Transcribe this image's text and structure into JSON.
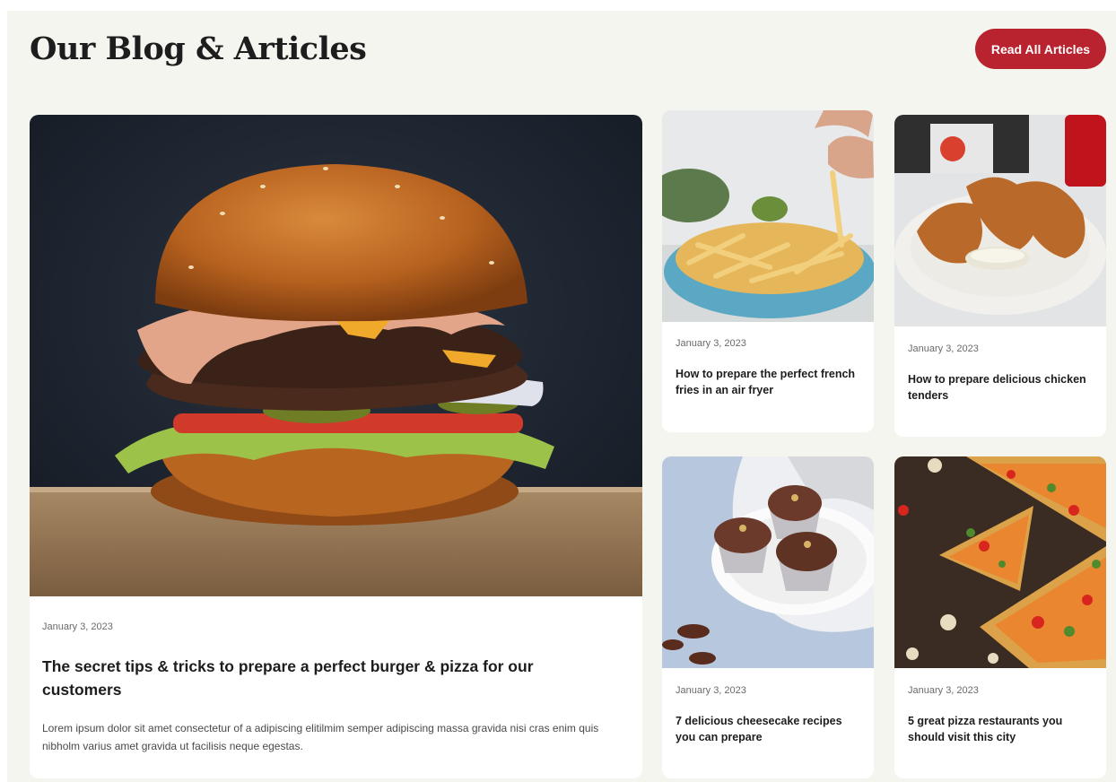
{
  "header": {
    "title": "Our Blog & Articles",
    "read_all_label": "Read All Articles"
  },
  "colors": {
    "accent": "#b8232f",
    "background": "#f5f5f0",
    "card": "#ffffff",
    "text": "#1d1d1d",
    "muted": "#6b6b6b"
  },
  "featured": {
    "image_icon": "burger-photo",
    "date": "January 3, 2023",
    "title": "The secret tips & tricks to prepare a perfect burger & pizza for our customers",
    "excerpt": "Lorem ipsum dolor sit amet consectetur of a adipiscing elitilmim semper adipiscing massa gravida nisi cras enim quis nibholm varius amet gravida ut facilisis neque egestas."
  },
  "articles": [
    {
      "image_icon": "french-fries-photo",
      "date": "January 3, 2023",
      "title": "How to prepare the perfect french fries in an air fryer"
    },
    {
      "image_icon": "chicken-tenders-photo",
      "date": "January 3, 2023",
      "title": "How to prepare delicious chicken tenders"
    },
    {
      "image_icon": "cupcakes-photo",
      "date": "January 3, 2023",
      "title": "7 delicious cheesecake recipes you can prepare"
    },
    {
      "image_icon": "pizza-photo",
      "date": "January 3, 2023",
      "title": "5 great pizza restaurants you should visit this city"
    }
  ]
}
